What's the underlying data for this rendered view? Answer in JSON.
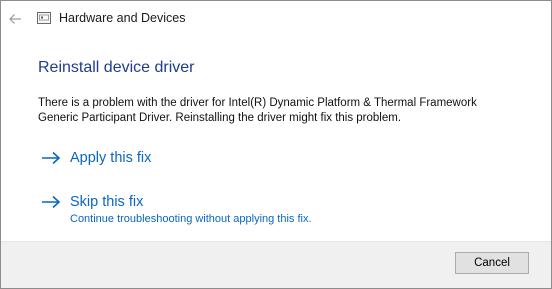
{
  "window": {
    "title": "Hardware and Devices"
  },
  "content": {
    "heading": "Reinstall device driver",
    "description": "There is a problem with the driver for Intel(R) Dynamic Platform & Thermal Framework Generic Participant Driver. Reinstalling the driver might fix this problem."
  },
  "options": {
    "apply": {
      "label": "Apply this fix",
      "icon": "arrow-right-icon"
    },
    "skip": {
      "label": "Skip this fix",
      "sublabel": "Continue troubleshooting without applying this fix.",
      "icon": "arrow-right-icon"
    }
  },
  "footer": {
    "cancel_label": "Cancel"
  },
  "colors": {
    "heading": "#1e3d8f",
    "link": "#0a66c2",
    "footer_bg": "#f0f0f0"
  }
}
